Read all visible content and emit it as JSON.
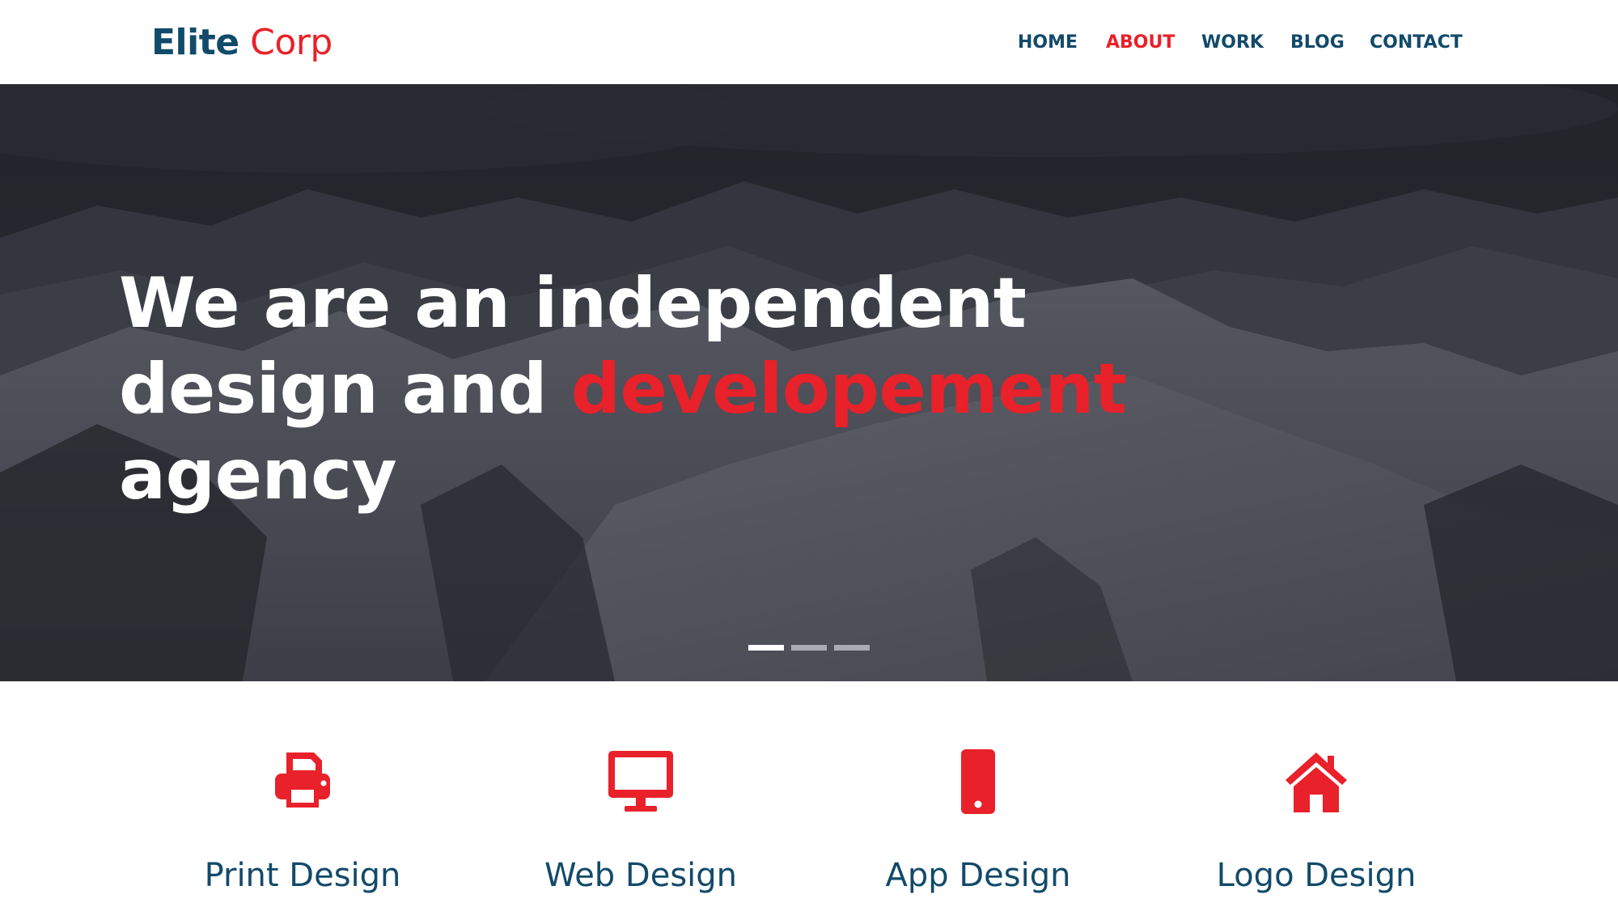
{
  "brand": {
    "name_primary": "Elite",
    "name_secondary": "Corp",
    "primary_color": "#124a6a",
    "accent_color": "#e8212a"
  },
  "nav": {
    "items": [
      {
        "label": "HOME",
        "active": false
      },
      {
        "label": "ABOUT",
        "active": true
      },
      {
        "label": "WORK",
        "active": false
      },
      {
        "label": "BLOG",
        "active": false
      },
      {
        "label": "CONTACT",
        "active": false
      }
    ]
  },
  "hero": {
    "line1": "We are an independent",
    "line2_start": "design and",
    "line2_accent": "developement",
    "line3": "agency",
    "slider": {
      "total_slides": 3,
      "active_slide": 1
    }
  },
  "services": [
    {
      "title": "Print Design",
      "icon": "printer-icon"
    },
    {
      "title": "Web Design",
      "icon": "monitor-icon"
    },
    {
      "title": "App Design",
      "icon": "mobile-phone-icon"
    },
    {
      "title": "Logo Design",
      "icon": "home-icon"
    }
  ]
}
